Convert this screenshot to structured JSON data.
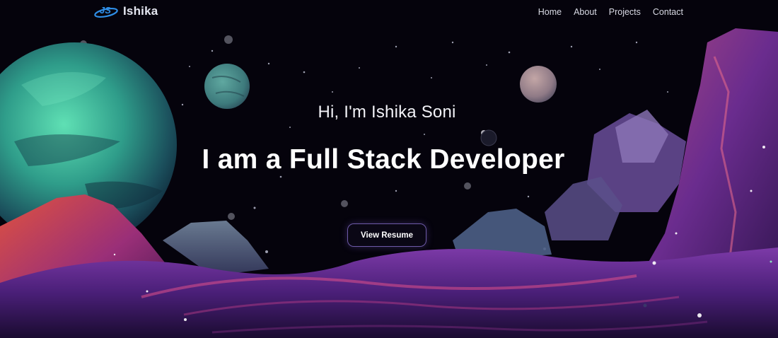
{
  "brand": {
    "logo_icon": "js-orbit-logo-icon",
    "name": "Ishika"
  },
  "nav": {
    "items": [
      {
        "label": "Home"
      },
      {
        "label": "About"
      },
      {
        "label": "Projects"
      },
      {
        "label": "Contact"
      }
    ]
  },
  "hero": {
    "greeting": "Hi, I'm Ishika Soni",
    "headline": "I am a Full Stack Developer",
    "cta_label": "View Resume"
  },
  "colors": {
    "background": "#05030c",
    "accent": "#6d5aa8",
    "logo_blue": "#2f8ee6"
  }
}
